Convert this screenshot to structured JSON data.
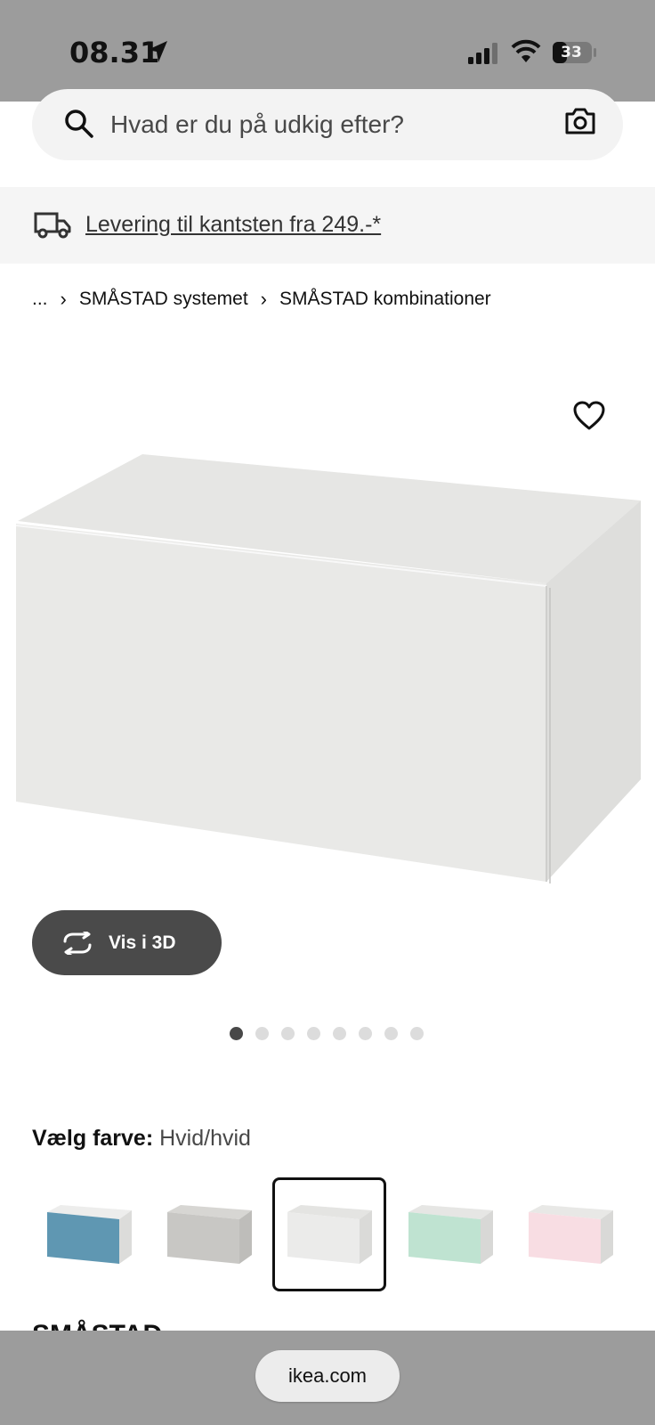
{
  "status_bar": {
    "time": "08.31",
    "battery": "33",
    "icons": [
      "location-arrow-icon",
      "signal-icon",
      "wifi-icon",
      "battery-icon"
    ]
  },
  "search": {
    "placeholder": "Hvad er du på udkig efter?",
    "icons": [
      "search-icon",
      "camera-icon"
    ]
  },
  "delivery": {
    "text": "Levering til kantsten fra 249.-*",
    "icon": "truck-icon"
  },
  "breadcrumb": {
    "items": [
      "...",
      "SMÅSTAD systemet",
      "SMÅSTAD kombinationer"
    ]
  },
  "product": {
    "favorite_icon": "heart-icon",
    "view3d_label": "Vis i 3D",
    "carousel": {
      "count": 8,
      "active_index": 0
    }
  },
  "color_select": {
    "label": "Vælg farve:",
    "value": "Hvid/hvid",
    "swatches": [
      {
        "color": "#5f97b2",
        "selected": false
      },
      {
        "color": "#c8c7c4",
        "selected": false
      },
      {
        "color": "#ebebea",
        "selected": true
      },
      {
        "color": "#bfe3d1",
        "selected": false
      },
      {
        "color": "#f8dde3",
        "selected": false
      }
    ]
  },
  "section_title": "SMÅSTAD",
  "browser": {
    "url": "ikea.com"
  }
}
